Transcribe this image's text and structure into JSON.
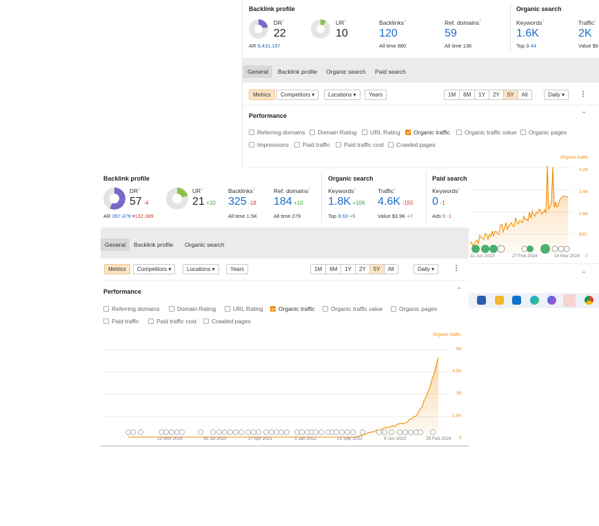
{
  "back": {
    "backlink_profile_title": "Backlink profile",
    "dr_label": "DR",
    "dr_value": "22",
    "ur_label": "UR",
    "ur_value": "10",
    "ar_label": "AR",
    "ar_value": "9,431,157",
    "backlinks_label": "Backlinks",
    "backlinks_value": "120",
    "backlinks_alltime_label": "All time",
    "backlinks_alltime": "880",
    "refdomains_label": "Ref. domains",
    "refdomains_value": "59",
    "refdomains_alltime_label": "All time",
    "refdomains_alltime": "136",
    "organic_title": "Organic search",
    "keywords_label": "Keywords",
    "keywords_value": "1.6K",
    "top3_label": "Top 3",
    "top3_value": "44",
    "traffic_label": "Traffic",
    "traffic_value": "2K",
    "traffic_value_label": "Value $6",
    "tabs": [
      "General",
      "Backlink profile",
      "Organic search",
      "Paid search"
    ],
    "toolbar": {
      "metrics": "Metrics",
      "competitors": "Competitors",
      "locations": "Locations",
      "years": "Years",
      "ranges": [
        "1M",
        "6M",
        "1Y",
        "2Y",
        "5Y",
        "All"
      ],
      "interval": "Daily"
    },
    "performance_title": "Performance",
    "options_row1": [
      "Referring domains",
      "Domain Rating",
      "URL Rating",
      "Organic traffic",
      "Organic traffic value",
      "Organic pages"
    ],
    "options_row2": [
      "Impressions",
      "Paid traffic",
      "Paid traffic cost",
      "Crawled pages"
    ],
    "chart_series_label": "Organic traffic",
    "yticks": [
      "3.2K",
      "2.4K",
      "1.6K",
      "800",
      "0"
    ],
    "xticks": [
      "11 Jun 2023",
      "27 Feb 2024",
      "14 Nov 2024"
    ]
  },
  "front": {
    "backlink_profile_title": "Backlink profile",
    "dr_label": "DR",
    "dr_value": "57",
    "dr_delta": "-4",
    "ur_label": "UR",
    "ur_value": "21",
    "ur_delta": "+10",
    "ar_label": "AR",
    "ar_value": "397,479",
    "ar_delta": "▾132,389",
    "backlinks_label": "Backlinks",
    "backlinks_value": "325",
    "backlinks_delta": "-18",
    "backlinks_alltime": "All time 1.5K",
    "refdomains_label": "Ref. domains",
    "refdomains_value": "184",
    "refdomains_delta": "+10",
    "refdomains_alltime": "All time 279",
    "organic_title": "Organic search",
    "keywords_label": "Keywords",
    "keywords_value": "1.8K",
    "keywords_delta": "+106",
    "top3_label": "Top 3",
    "top3_value": "63",
    "top3_delta": "+5",
    "traffic_label": "Traffic",
    "traffic_value": "4.6K",
    "traffic_delta": "-155",
    "traffic_value_text": "Value $3.9K",
    "traffic_value_delta": "+7",
    "paid_title": "Paid search",
    "paid_keywords_label": "Keywords",
    "paid_keywords_value": "0",
    "paid_keywords_delta": "-1",
    "ads_label": "Ads",
    "ads_value": "0",
    "ads_delta": "-1",
    "tabs": [
      "General",
      "Backlink profile",
      "Organic search"
    ],
    "toolbar": {
      "metrics": "Metrics",
      "competitors": "Competitors",
      "locations": "Locations",
      "years": "Years",
      "ranges": [
        "1M",
        "6M",
        "1Y",
        "2Y",
        "5Y",
        "All"
      ],
      "interval": "Daily"
    },
    "performance_title": "Performance",
    "options_row1": [
      "Referring domains",
      "Domain Rating",
      "URL Rating",
      "Organic traffic",
      "Organic traffic value",
      "Organic pages"
    ],
    "options_row2": [
      "Paid traffic",
      "Paid traffic cost",
      "Crawled pages"
    ],
    "chart_series_label": "Organic traffic",
    "yticks": [
      "6K",
      "4.5K",
      "3K",
      "1.5K",
      "0"
    ],
    "xticks": [
      "12 Nov 2018",
      "30 Jul 2020",
      "17 Apr 2021",
      "3 Jan 2022",
      "21 Sep 2022",
      "9 Jun 2023",
      "25 Feb 2024"
    ]
  },
  "colors": {
    "accent": "#f08a00",
    "dr_ring": "#7b68c8",
    "ur_ring": "#8bc34a",
    "link": "#1b6ac9",
    "up": "#3a9e3a",
    "down": "#d23a2b"
  },
  "taskbar_icons": [
    "store-icon",
    "folder-icon",
    "outlook-icon",
    "edge-icon",
    "copilot-icon",
    "chrome-active-icon",
    "chrome-icon"
  ]
}
